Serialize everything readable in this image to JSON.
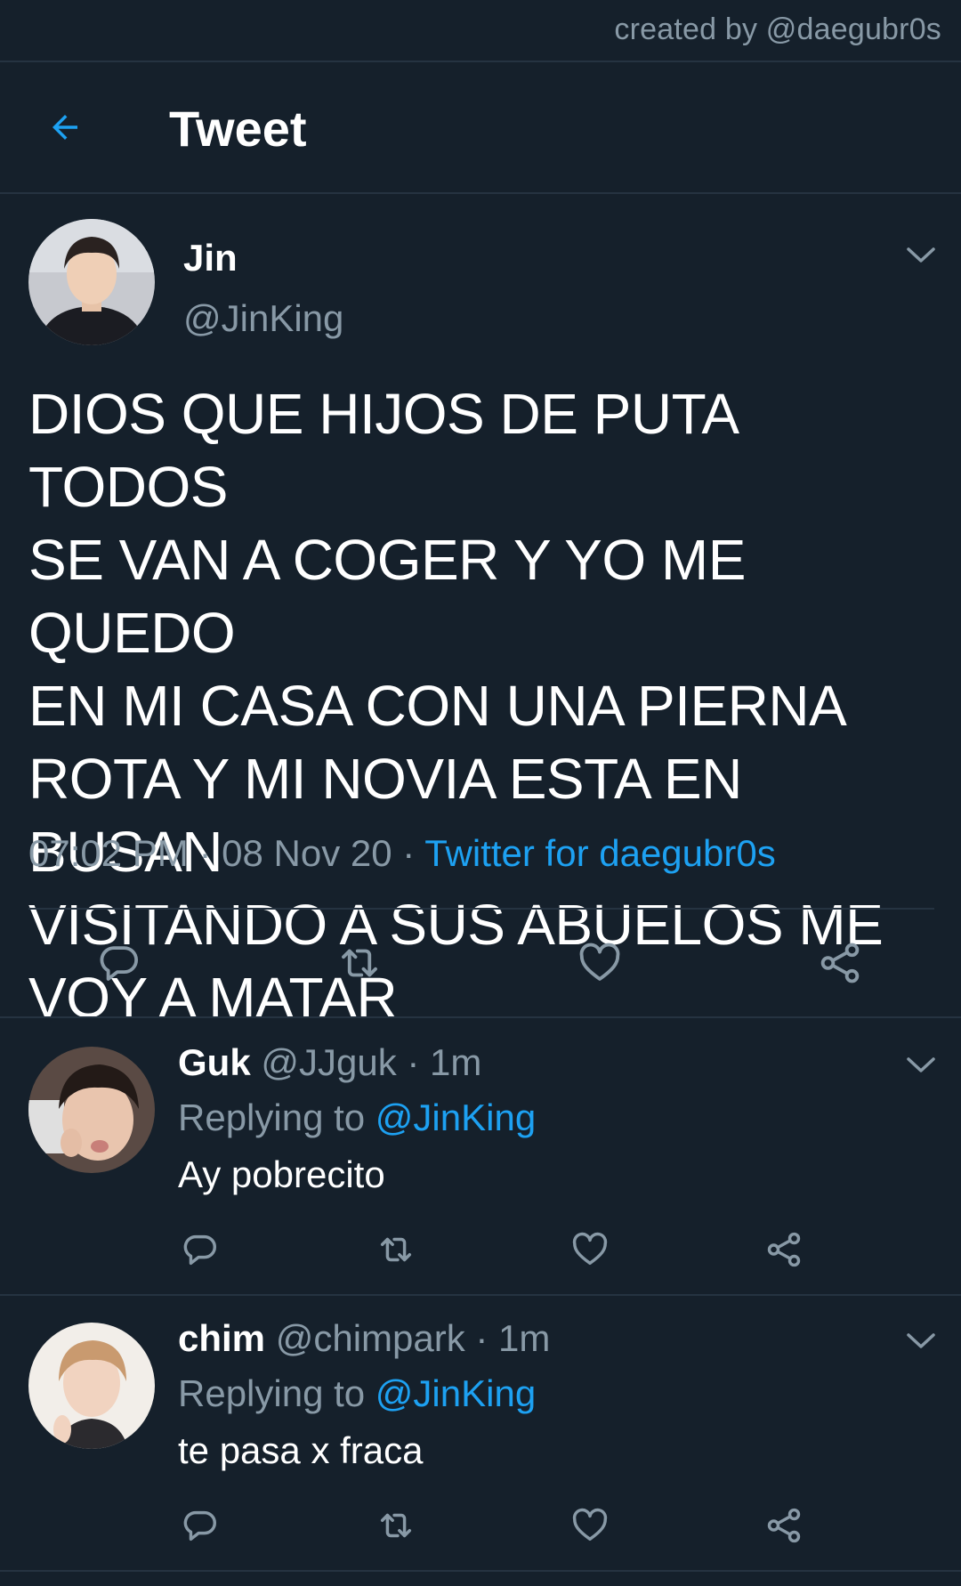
{
  "watermark": "created by @daegubr0s",
  "header": {
    "title": "Tweet",
    "back_icon": "arrow-left-icon"
  },
  "colors": {
    "background": "#15202b",
    "divider": "#253341",
    "secondary_text": "#8899a6",
    "accent": "#1da1f2"
  },
  "tweet": {
    "author_name": "Jin",
    "author_handle": "@JinKing",
    "lines": [
      "DIOS QUE HIJOS DE PUTA TODOS",
      "SE VAN A COGER Y YO ME QUEDO",
      "EN MI CASA CON UNA PIERNA",
      "ROTA Y MI NOVIA ESTA EN BUSAN",
      "VISITANDO A SUS ABUELOS ME",
      "VOY A MATAR"
    ],
    "time": "07:02 PM",
    "sep": "·",
    "date": "08 Nov 20",
    "source": "Twitter for daegubr0s",
    "actions": [
      "reply-icon",
      "retweet-icon",
      "like-icon",
      "share-icon"
    ]
  },
  "replies": [
    {
      "name": "Guk",
      "handle": "@JJguk",
      "time_ago": "· 1m",
      "replying_to_label": "Replying to",
      "replying_to_handle": "@JinKing",
      "text": "Ay pobrecito"
    },
    {
      "name": "chim",
      "handle": "@chimpark",
      "time_ago": "· 1m",
      "replying_to_label": "Replying to",
      "replying_to_handle": "@JinKing",
      "text": "te pasa x fraca"
    }
  ]
}
